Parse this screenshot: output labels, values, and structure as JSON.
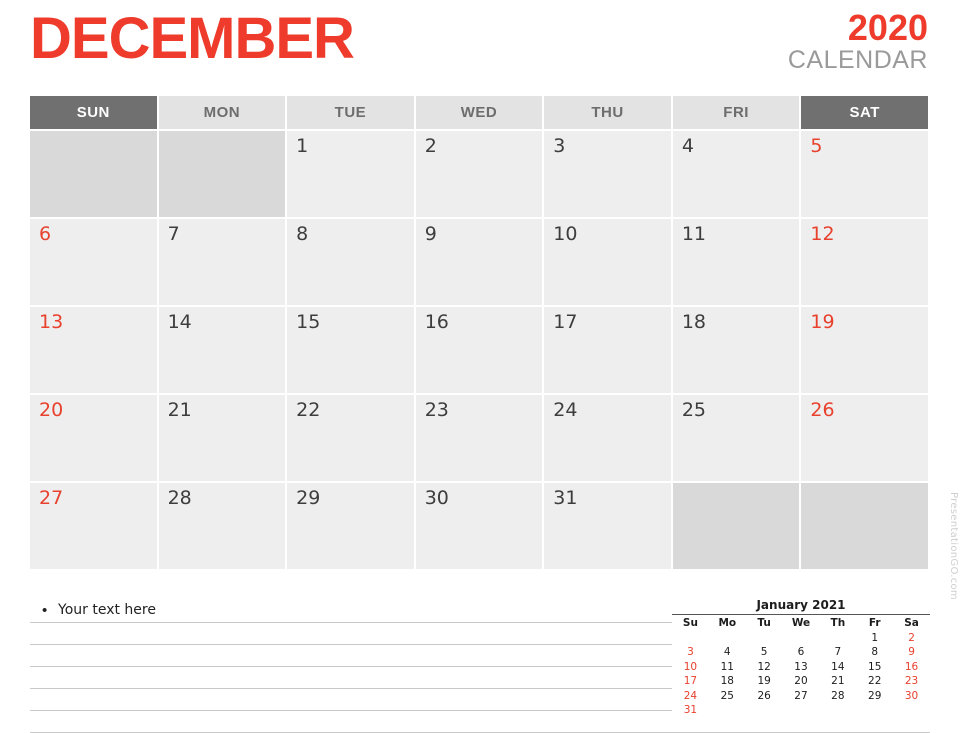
{
  "header": {
    "month": "DECEMBER",
    "year": "2020",
    "calendar_word": "CALENDAR",
    "accent_color": "#ee3b2b",
    "muted_color": "#9a9a9a"
  },
  "calendar": {
    "day_headers": [
      {
        "label": "SUN",
        "type": "weekend"
      },
      {
        "label": "MON",
        "type": "weekday"
      },
      {
        "label": "TUE",
        "type": "weekday"
      },
      {
        "label": "WED",
        "type": "weekday"
      },
      {
        "label": "THU",
        "type": "weekday"
      },
      {
        "label": "FRI",
        "type": "weekday"
      },
      {
        "label": "SAT",
        "type": "weekend"
      }
    ],
    "weeks": [
      [
        "",
        "",
        "1",
        "2",
        "3",
        "4",
        "5"
      ],
      [
        "6",
        "7",
        "8",
        "9",
        "10",
        "11",
        "12"
      ],
      [
        "13",
        "14",
        "15",
        "16",
        "17",
        "18",
        "19"
      ],
      [
        "20",
        "21",
        "22",
        "23",
        "24",
        "25",
        "26"
      ],
      [
        "27",
        "28",
        "29",
        "30",
        "31",
        "",
        ""
      ]
    ]
  },
  "notes": {
    "bullet": "•",
    "first_line_text": "Your text here",
    "blank_line_count": 5
  },
  "mini_calendar": {
    "title": "January 2021",
    "day_headers": [
      "Su",
      "Mo",
      "Tu",
      "We",
      "Th",
      "Fr",
      "Sa"
    ],
    "weeks": [
      [
        "",
        "",
        "",
        "",
        "",
        "1",
        "2"
      ],
      [
        "3",
        "4",
        "5",
        "6",
        "7",
        "8",
        "9"
      ],
      [
        "10",
        "11",
        "12",
        "13",
        "14",
        "15",
        "16"
      ],
      [
        "17",
        "18",
        "19",
        "20",
        "21",
        "22",
        "23"
      ],
      [
        "24",
        "25",
        "26",
        "27",
        "28",
        "29",
        "30"
      ],
      [
        "31",
        "",
        "",
        "",
        "",
        "",
        ""
      ]
    ]
  },
  "watermark": {
    "text": "PresentationGO.com"
  }
}
